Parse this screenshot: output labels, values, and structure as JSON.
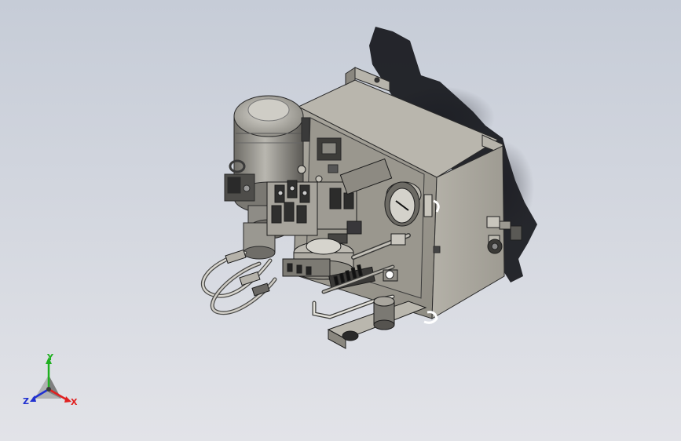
{
  "viewport": {
    "model": "hydraulic-power-unit-assembly",
    "background": {
      "top": "#c6ccd7",
      "bottom": "#e2e3e8"
    }
  },
  "triad": {
    "x_label": "X",
    "y_label": "Y",
    "z_label": "Z",
    "colors": {
      "x": "#e02020",
      "y": "#20b020",
      "z": "#2030d0"
    }
  }
}
